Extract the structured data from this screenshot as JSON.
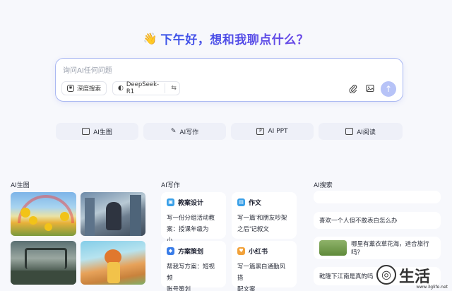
{
  "greeting": {
    "emoji": "👋",
    "text": "下午好，想和我聊点什么？"
  },
  "chatbox": {
    "placeholder": "询问AI任何问题",
    "deep_search_label": "深度搜索",
    "model_label": "DeepSeek-R1"
  },
  "quick_actions": [
    {
      "label": "AI生图",
      "icon": "image-icon"
    },
    {
      "label": "AI写作",
      "icon": "pen-icon"
    },
    {
      "label": "AI PPT",
      "icon": "ppt-icon"
    },
    {
      "label": "AI阅读",
      "icon": "book-icon"
    }
  ],
  "sections": {
    "image": {
      "title": "AI生图"
    },
    "writing": {
      "title": "AI写作",
      "cards": [
        {
          "title": "教案设计",
          "text": [
            "写一份分组活动教",
            "案：授课年级为小..."
          ],
          "color": "#3aa0e8"
        },
        {
          "title": "作文",
          "text": [
            "写一篇'和朋友吵架",
            "之后'记叙文"
          ],
          "color": "#3aa0e8"
        },
        {
          "title": "方案策划",
          "text": [
            "帮我写方案：短视频",
            "账号策划"
          ],
          "color": "#3a7de8"
        },
        {
          "title": "小红书",
          "text": [
            "写一篇黑白通勤风搭",
            "配文案"
          ],
          "color": "#f2a23a"
        }
      ]
    },
    "search": {
      "title": "AI搜索",
      "items": [
        {
          "text": "喜欢一个人但不敢表白怎么办"
        },
        {
          "text": "哪里有薰衣草花海，适合旅行吗？"
        },
        {
          "text": "乾隆下江南是真的吗"
        }
      ]
    }
  },
  "watermark": {
    "text": "生活",
    "url": "www.3glife.net"
  }
}
